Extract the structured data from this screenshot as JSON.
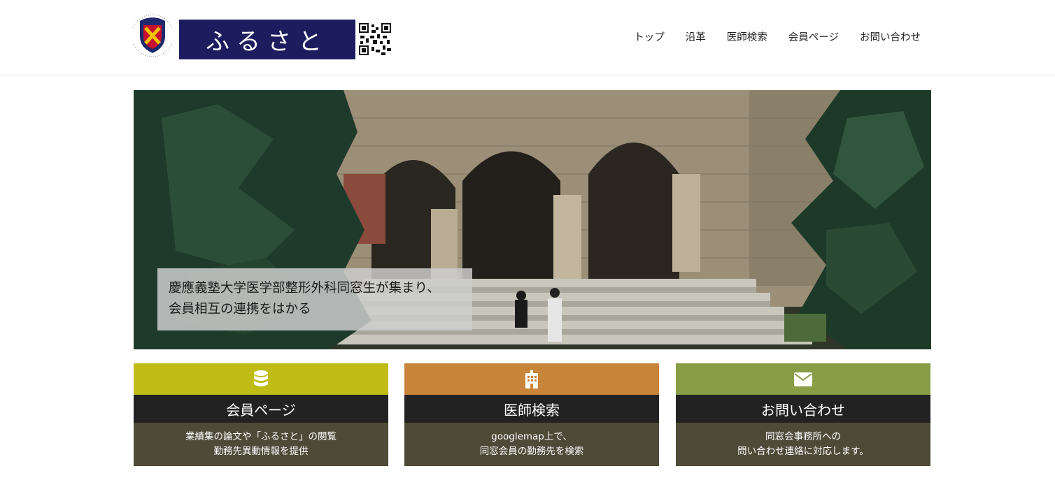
{
  "header": {
    "seal_icon": "keio-university-crest",
    "banner_text": "ふるさと",
    "qr_icon": "qr-code-icon"
  },
  "nav": {
    "items": [
      {
        "label": "トップ"
      },
      {
        "label": "沿革"
      },
      {
        "label": "医師検索"
      },
      {
        "label": "会員ページ"
      },
      {
        "label": "お問い合わせ"
      }
    ]
  },
  "hero": {
    "line1": "慶應義塾大学医学部整形外科同窓生が集まり、",
    "line2": "会員相互の連携をはかる"
  },
  "cards": [
    {
      "icon": "database-icon",
      "color": "#bfbc16",
      "title": "会員ページ",
      "line1": "業績集の論文や「ふるさと」の閲覧",
      "line2": "勤務先異動情報を提供"
    },
    {
      "icon": "building-icon",
      "color": "#c8853a",
      "title": "医師検索",
      "line1": "googlemap上で、",
      "line2": "同窓会員の勤務先を検索"
    },
    {
      "icon": "envelope-icon",
      "color": "#889d46",
      "title": "お問い合わせ",
      "line1": "同窓会事務所への",
      "line2": "問い合わせ連絡に対応します。"
    }
  ]
}
